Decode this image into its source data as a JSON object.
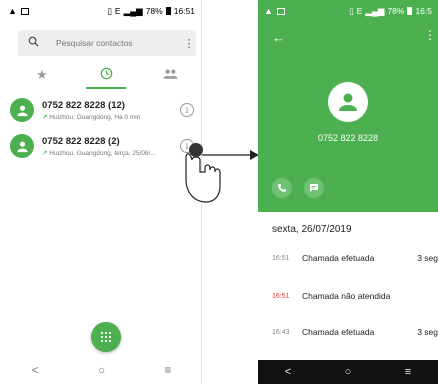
{
  "left_phone": {
    "status": {
      "battery": "78%",
      "time": "16:51",
      "network": "E"
    },
    "search": {
      "placeholder": "Pesquisar contactos"
    },
    "tabs": [
      {
        "name": "favorites",
        "icon": "star-icon"
      },
      {
        "name": "recent",
        "icon": "clock-icon",
        "active": true
      },
      {
        "name": "contacts",
        "icon": "people-icon"
      }
    ],
    "calls": [
      {
        "number": "0752 822 8228",
        "count": "(12)",
        "detail": "Huizhou, Guangdong, Há 0 min"
      },
      {
        "number": "0752 822 8228",
        "count": "(2)",
        "detail": "Huizhou, Guangdong, terça, 25/06/..."
      }
    ],
    "nav": {
      "back": "<",
      "home": "○",
      "menu": "≡"
    }
  },
  "right_phone": {
    "status": {
      "battery": "78%",
      "time": "16:5",
      "network": "E"
    },
    "number": "0752 822 8228",
    "date_heading": "sexta, 26/07/2019",
    "log": [
      {
        "time": "16:51",
        "label": "Chamada efetuada",
        "duration": "3 seg",
        "missed": false
      },
      {
        "time": "16:51",
        "label": "Chamada não atendida",
        "duration": "",
        "missed": true
      },
      {
        "time": "16:43",
        "label": "Chamada efetuada",
        "duration": "3 seg",
        "missed": false
      }
    ],
    "nav": {
      "back": "<",
      "home": "○",
      "menu": "≡"
    }
  },
  "colors": {
    "accent": "#4caf50",
    "missed": "#e53935"
  }
}
